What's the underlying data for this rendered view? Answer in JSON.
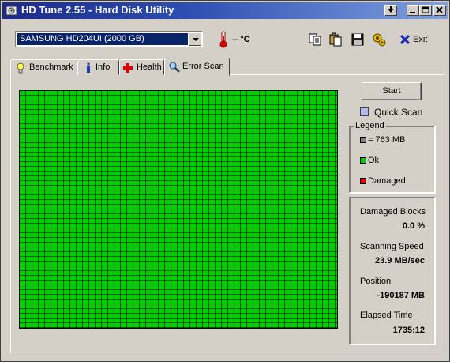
{
  "window": {
    "title": "HD Tune 2.55 - Hard Disk Utility"
  },
  "toolbar": {
    "drive": "SAMSUNG HD204UI (2000 GB)",
    "temperature": "-- °C",
    "exit_label": "Exit",
    "icons": [
      "copy-icon",
      "paste-icon",
      "save-icon",
      "options-icon",
      "exit-icon"
    ]
  },
  "tabs": [
    {
      "label": "Benchmark",
      "icon": "benchmark-icon"
    },
    {
      "label": "Info",
      "icon": "info-icon"
    },
    {
      "label": "Health",
      "icon": "health-icon"
    },
    {
      "label": "Error Scan",
      "icon": "magnifier-icon",
      "active": true
    }
  ],
  "controls": {
    "start_label": "Start",
    "quick_scan_label": "Quick Scan",
    "quick_scan_checked": false
  },
  "legend": {
    "title": "Legend",
    "items": [
      {
        "label": "= 763 MB",
        "color": "#808080"
      },
      {
        "label": "Ok",
        "color": "#00d000"
      },
      {
        "label": "Damaged",
        "color": "#e00000"
      }
    ]
  },
  "stats": {
    "damaged_blocks_label": "Damaged Blocks",
    "damaged_blocks_value": "0.0 %",
    "scanning_speed_label": "Scanning Speed",
    "scanning_speed_value": "23.9 MB/sec",
    "position_label": "Position",
    "position_value": "-190187 MB",
    "elapsed_time_label": "Elapsed Time",
    "elapsed_time_value": "1735:12"
  },
  "colors": {
    "ok": "#00d000",
    "damaged": "#e00000",
    "title_start": "#1c2a8a",
    "title_end": "#7fa0e0"
  }
}
